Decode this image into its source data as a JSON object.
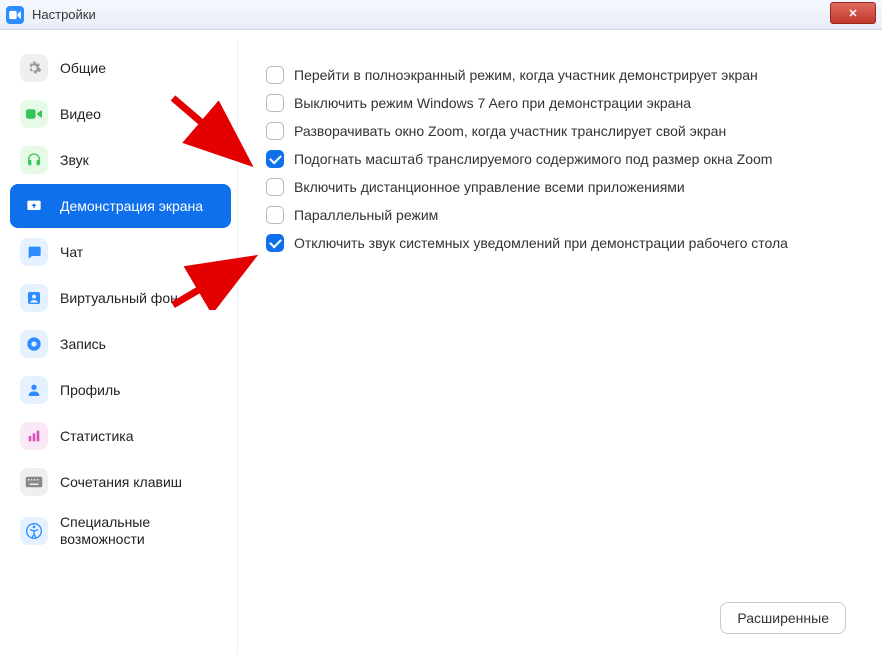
{
  "window": {
    "title": "Настройки"
  },
  "sidebar": {
    "items": [
      {
        "label": "Общие"
      },
      {
        "label": "Видео"
      },
      {
        "label": "Звук"
      },
      {
        "label": "Демонстрация экрана"
      },
      {
        "label": "Чат"
      },
      {
        "label": "Виртуальный фон"
      },
      {
        "label": "Запись"
      },
      {
        "label": "Профиль"
      },
      {
        "label": "Статистика"
      },
      {
        "label": "Сочетания клавиш"
      },
      {
        "label": "Специальные возможности"
      }
    ]
  },
  "content": {
    "options": [
      {
        "label": "Перейти в полноэкранный режим, когда участник демонстрирует экран",
        "checked": false
      },
      {
        "label": "Выключить режим Windows 7 Aero при демонстрации экрана",
        "checked": false
      },
      {
        "label": "Разворачивать окно Zoom, когда участник транслирует свой экран",
        "checked": false
      },
      {
        "label": "Подогнать масштаб транслируемого содержимого под размер окна Zoom",
        "checked": true
      },
      {
        "label": "Включить дистанционное управление всеми приложениями",
        "checked": false
      },
      {
        "label": "Параллельный режим",
        "checked": false
      },
      {
        "label": "Отключить звук системных уведомлений при демонстрации рабочего стола",
        "checked": true
      }
    ],
    "advanced_label": "Расширенные"
  }
}
